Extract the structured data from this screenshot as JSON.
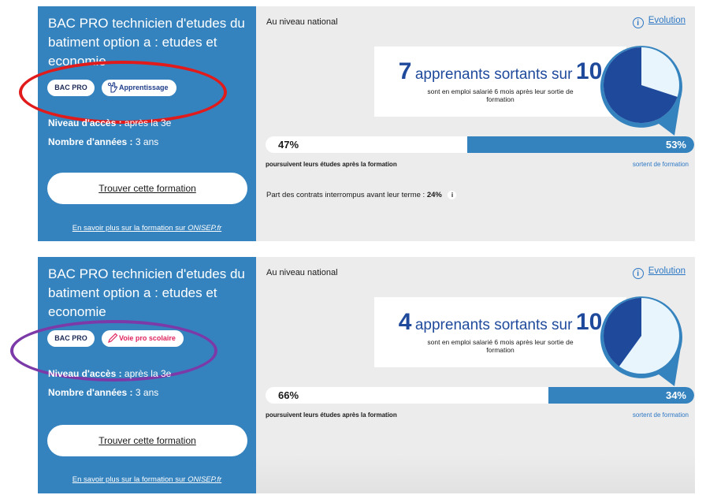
{
  "cards": [
    {
      "title": "BAC PRO technicien d'etudes du batiment option a : etudes et economie",
      "badge_type": "BAC PRO",
      "badge_voie": "Apprentissage",
      "badge_voie_color": "#1f3d8a",
      "voie_icon": "hand-icon",
      "niveau_label": "Niveau d'accès :",
      "niveau_value": "après la 3e",
      "annees_label": "Nombre d'années :",
      "annees_value": "3 ans",
      "find_button": "Trouver cette formation",
      "onisep_link_text": "En savoir plus sur la formation sur",
      "onisep_site": "ONISEP.fr",
      "national_label": "Au niveau national",
      "evolution_link": "Evolution",
      "stat_num": "7",
      "stat_text": "apprenants sortants sur",
      "stat_total": "10",
      "stat_sub": "sont en emploi salarié 6 mois après leur sortie de formation",
      "pie_fraction": 0.7,
      "bar_left_value": "47%",
      "bar_right_value": "53%",
      "bar_right_fraction": 0.53,
      "bar_left_label": "poursuivent leurs études après la formation",
      "bar_right_label": "sortent de formation",
      "interrupt_text": "Part des contrats interrompus avant leur terme :",
      "interrupt_value": "24%",
      "interrupt_info": "i"
    },
    {
      "title": "BAC PRO technicien d'etudes du batiment option a : etudes et economie",
      "badge_type": "BAC PRO",
      "badge_voie": "Voie pro scolaire",
      "badge_voie_color": "#e0245e",
      "voie_icon": "pencil-icon",
      "niveau_label": "Niveau d'accès :",
      "niveau_value": "après la 3e",
      "annees_label": "Nombre d'années :",
      "annees_value": "3 ans",
      "find_button": "Trouver cette formation",
      "onisep_link_text": "En savoir plus sur la formation sur",
      "onisep_site": "ONISEP.fr",
      "national_label": "Au niveau national",
      "evolution_link": "Evolution",
      "stat_num": "4",
      "stat_text": "apprenants sortants sur",
      "stat_total": "10",
      "stat_sub": "sont en emploi salarié 6 mois après leur sortie de formation",
      "pie_fraction": 0.4,
      "bar_left_value": "66%",
      "bar_right_value": "34%",
      "bar_right_fraction": 0.34,
      "bar_left_label": "poursuivent leurs études après la formation",
      "bar_right_label": "sortent de formation"
    }
  ],
  "evolution_icon": "info-circle-icon",
  "colors": {
    "card_blue": "#3583be",
    "navy": "#1f4a9c",
    "pie_light": "#e8f5fd",
    "annotation_red": "#e11b1b",
    "annotation_purple": "#7c3aa8"
  }
}
